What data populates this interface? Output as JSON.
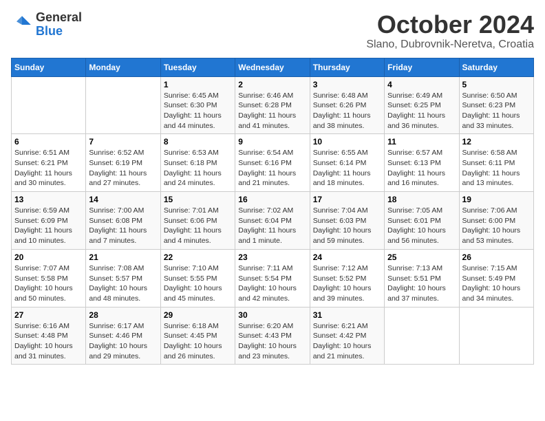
{
  "logo": {
    "general": "General",
    "blue": "Blue"
  },
  "title": "October 2024",
  "location": "Slano, Dubrovnik-Neretva, Croatia",
  "headers": [
    "Sunday",
    "Monday",
    "Tuesday",
    "Wednesday",
    "Thursday",
    "Friday",
    "Saturday"
  ],
  "weeks": [
    [
      {
        "day": "",
        "sunrise": "",
        "sunset": "",
        "daylight": ""
      },
      {
        "day": "",
        "sunrise": "",
        "sunset": "",
        "daylight": ""
      },
      {
        "day": "1",
        "sunrise": "Sunrise: 6:45 AM",
        "sunset": "Sunset: 6:30 PM",
        "daylight": "Daylight: 11 hours and 44 minutes."
      },
      {
        "day": "2",
        "sunrise": "Sunrise: 6:46 AM",
        "sunset": "Sunset: 6:28 PM",
        "daylight": "Daylight: 11 hours and 41 minutes."
      },
      {
        "day": "3",
        "sunrise": "Sunrise: 6:48 AM",
        "sunset": "Sunset: 6:26 PM",
        "daylight": "Daylight: 11 hours and 38 minutes."
      },
      {
        "day": "4",
        "sunrise": "Sunrise: 6:49 AM",
        "sunset": "Sunset: 6:25 PM",
        "daylight": "Daylight: 11 hours and 36 minutes."
      },
      {
        "day": "5",
        "sunrise": "Sunrise: 6:50 AM",
        "sunset": "Sunset: 6:23 PM",
        "daylight": "Daylight: 11 hours and 33 minutes."
      }
    ],
    [
      {
        "day": "6",
        "sunrise": "Sunrise: 6:51 AM",
        "sunset": "Sunset: 6:21 PM",
        "daylight": "Daylight: 11 hours and 30 minutes."
      },
      {
        "day": "7",
        "sunrise": "Sunrise: 6:52 AM",
        "sunset": "Sunset: 6:19 PM",
        "daylight": "Daylight: 11 hours and 27 minutes."
      },
      {
        "day": "8",
        "sunrise": "Sunrise: 6:53 AM",
        "sunset": "Sunset: 6:18 PM",
        "daylight": "Daylight: 11 hours and 24 minutes."
      },
      {
        "day": "9",
        "sunrise": "Sunrise: 6:54 AM",
        "sunset": "Sunset: 6:16 PM",
        "daylight": "Daylight: 11 hours and 21 minutes."
      },
      {
        "day": "10",
        "sunrise": "Sunrise: 6:55 AM",
        "sunset": "Sunset: 6:14 PM",
        "daylight": "Daylight: 11 hours and 18 minutes."
      },
      {
        "day": "11",
        "sunrise": "Sunrise: 6:57 AM",
        "sunset": "Sunset: 6:13 PM",
        "daylight": "Daylight: 11 hours and 16 minutes."
      },
      {
        "day": "12",
        "sunrise": "Sunrise: 6:58 AM",
        "sunset": "Sunset: 6:11 PM",
        "daylight": "Daylight: 11 hours and 13 minutes."
      }
    ],
    [
      {
        "day": "13",
        "sunrise": "Sunrise: 6:59 AM",
        "sunset": "Sunset: 6:09 PM",
        "daylight": "Daylight: 11 hours and 10 minutes."
      },
      {
        "day": "14",
        "sunrise": "Sunrise: 7:00 AM",
        "sunset": "Sunset: 6:08 PM",
        "daylight": "Daylight: 11 hours and 7 minutes."
      },
      {
        "day": "15",
        "sunrise": "Sunrise: 7:01 AM",
        "sunset": "Sunset: 6:06 PM",
        "daylight": "Daylight: 11 hours and 4 minutes."
      },
      {
        "day": "16",
        "sunrise": "Sunrise: 7:02 AM",
        "sunset": "Sunset: 6:04 PM",
        "daylight": "Daylight: 11 hours and 1 minute."
      },
      {
        "day": "17",
        "sunrise": "Sunrise: 7:04 AM",
        "sunset": "Sunset: 6:03 PM",
        "daylight": "Daylight: 10 hours and 59 minutes."
      },
      {
        "day": "18",
        "sunrise": "Sunrise: 7:05 AM",
        "sunset": "Sunset: 6:01 PM",
        "daylight": "Daylight: 10 hours and 56 minutes."
      },
      {
        "day": "19",
        "sunrise": "Sunrise: 7:06 AM",
        "sunset": "Sunset: 6:00 PM",
        "daylight": "Daylight: 10 hours and 53 minutes."
      }
    ],
    [
      {
        "day": "20",
        "sunrise": "Sunrise: 7:07 AM",
        "sunset": "Sunset: 5:58 PM",
        "daylight": "Daylight: 10 hours and 50 minutes."
      },
      {
        "day": "21",
        "sunrise": "Sunrise: 7:08 AM",
        "sunset": "Sunset: 5:57 PM",
        "daylight": "Daylight: 10 hours and 48 minutes."
      },
      {
        "day": "22",
        "sunrise": "Sunrise: 7:10 AM",
        "sunset": "Sunset: 5:55 PM",
        "daylight": "Daylight: 10 hours and 45 minutes."
      },
      {
        "day": "23",
        "sunrise": "Sunrise: 7:11 AM",
        "sunset": "Sunset: 5:54 PM",
        "daylight": "Daylight: 10 hours and 42 minutes."
      },
      {
        "day": "24",
        "sunrise": "Sunrise: 7:12 AM",
        "sunset": "Sunset: 5:52 PM",
        "daylight": "Daylight: 10 hours and 39 minutes."
      },
      {
        "day": "25",
        "sunrise": "Sunrise: 7:13 AM",
        "sunset": "Sunset: 5:51 PM",
        "daylight": "Daylight: 10 hours and 37 minutes."
      },
      {
        "day": "26",
        "sunrise": "Sunrise: 7:15 AM",
        "sunset": "Sunset: 5:49 PM",
        "daylight": "Daylight: 10 hours and 34 minutes."
      }
    ],
    [
      {
        "day": "27",
        "sunrise": "Sunrise: 6:16 AM",
        "sunset": "Sunset: 4:48 PM",
        "daylight": "Daylight: 10 hours and 31 minutes."
      },
      {
        "day": "28",
        "sunrise": "Sunrise: 6:17 AM",
        "sunset": "Sunset: 4:46 PM",
        "daylight": "Daylight: 10 hours and 29 minutes."
      },
      {
        "day": "29",
        "sunrise": "Sunrise: 6:18 AM",
        "sunset": "Sunset: 4:45 PM",
        "daylight": "Daylight: 10 hours and 26 minutes."
      },
      {
        "day": "30",
        "sunrise": "Sunrise: 6:20 AM",
        "sunset": "Sunset: 4:43 PM",
        "daylight": "Daylight: 10 hours and 23 minutes."
      },
      {
        "day": "31",
        "sunrise": "Sunrise: 6:21 AM",
        "sunset": "Sunset: 4:42 PM",
        "daylight": "Daylight: 10 hours and 21 minutes."
      },
      {
        "day": "",
        "sunrise": "",
        "sunset": "",
        "daylight": ""
      },
      {
        "day": "",
        "sunrise": "",
        "sunset": "",
        "daylight": ""
      }
    ]
  ]
}
